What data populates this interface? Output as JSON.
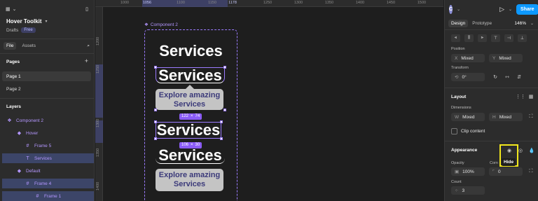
{
  "left": {
    "project_name": "Hover Toolkit",
    "drafts_label": "Drafts",
    "plan_badge": "Free",
    "tabs": [
      "File",
      "Assets"
    ],
    "pages_title": "Pages",
    "pages": [
      "Page 1",
      "Page 2"
    ],
    "layers_title": "Layers",
    "layers": [
      {
        "label": "Component 2",
        "icon": "component-set-icon",
        "indent": 0,
        "selected": false
      },
      {
        "label": "Hover",
        "icon": "component-icon",
        "indent": 1,
        "selected": false
      },
      {
        "label": "Frame 5",
        "icon": "frame-icon",
        "indent": 2,
        "selected": false
      },
      {
        "label": "Services",
        "icon": "text-icon",
        "indent": 2,
        "selected": true
      },
      {
        "label": "Default",
        "icon": "component-icon",
        "indent": 1,
        "selected": false
      },
      {
        "label": "Frame 4",
        "icon": "frame-icon",
        "indent": 2,
        "selected": true
      },
      {
        "label": "Frame 1",
        "icon": "frame-icon",
        "indent": 3,
        "selected": false
      }
    ]
  },
  "canvas": {
    "ruler_top": [
      "1000",
      "1056",
      "1100",
      "1150",
      "1178",
      "1250",
      "1300",
      "1350",
      "1400",
      "1450",
      "1500",
      "1550"
    ],
    "ruler_left": [
      "1200",
      "1250",
      "1300",
      "1350",
      "1400"
    ],
    "component_label": "Component 2",
    "services_text": "Services",
    "tooltip_text": "Explore amazing Services",
    "dim_a": {
      "w": "122",
      "h": "74"
    },
    "dim_b": {
      "w": "106",
      "h": "30"
    }
  },
  "right": {
    "avatar_letter": "C",
    "share_label": "Share",
    "tabs": [
      "Design",
      "Prototype"
    ],
    "zoom": "146%",
    "position_label": "Position",
    "x_key": "X",
    "x_value": "Mixed",
    "y_key": "Y",
    "y_value": "Mixed",
    "transform_label": "Transform",
    "rotation": "0°",
    "layout_title": "Layout",
    "dimensions_label": "Dimensions",
    "w_key": "W",
    "w_value": "Mixed",
    "h_key": "H",
    "h_value": "Mixed",
    "clip_label": "Clip content",
    "appearance_title": "Appearance",
    "hide_tooltip": "Hide",
    "opacity_label": "Opacity",
    "opacity_value": "100%",
    "corner_label": "Corn",
    "corner_value": "0",
    "count_label": "Count",
    "count_value": "3"
  },
  "colors": {
    "accent": "#0d99ff",
    "component": "#9b7bff",
    "highlight": "#f2e71c",
    "selection": "#3c4568"
  }
}
